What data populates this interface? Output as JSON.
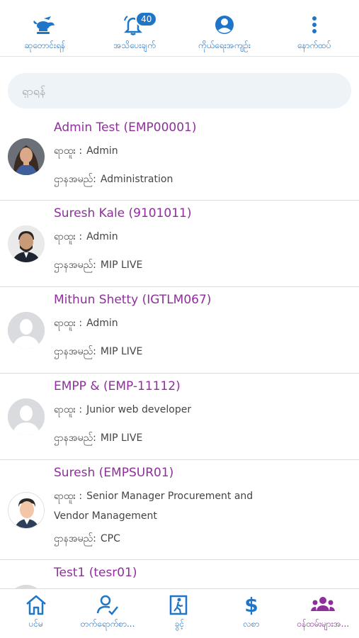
{
  "top_nav": {
    "items": [
      {
        "label": "ဆုတောင်းရန်",
        "icon": "teapot-lamp-icon"
      },
      {
        "label": "အသိပေးချက်",
        "icon": "bell-icon",
        "badge": "40"
      },
      {
        "label": "ကိုယ်ရေးအကျဉ်း",
        "icon": "account-circle-icon"
      },
      {
        "label": "နောက်ထပ်",
        "icon": "more-vertical-icon"
      }
    ]
  },
  "search": {
    "placeholder": "ရှာရန်"
  },
  "employees": {
    "position_label": "ရာထူး :",
    "department_label": "ဌာနအမည်:",
    "items": [
      {
        "name": "Admin Test (EMP00001)",
        "position": "Admin",
        "department": "Administration",
        "avatar": "photo-woman"
      },
      {
        "name": "Suresh Kale (9101011)",
        "position": "Admin",
        "department": "MIP LIVE",
        "avatar": "photo-man"
      },
      {
        "name": "Mithun Shetty (IGTLM067)",
        "position": "Admin",
        "department": "MIP LIVE",
        "avatar": "placeholder"
      },
      {
        "name": "EMPP & (EMP-11112)",
        "position": "Junior web developer",
        "department": "MIP LIVE",
        "avatar": "placeholder"
      },
      {
        "name": "Suresh (EMPSUR01)",
        "position": "Senior Manager  Procurement and",
        "position_cont": "Vendor Management",
        "department": "CPC",
        "avatar": "cartoon-man"
      },
      {
        "name": "Test1 (tesr01)",
        "avatar": "placeholder"
      }
    ]
  },
  "bottom_nav": {
    "items": [
      {
        "label": "ပင်မ",
        "icon": "home-icon"
      },
      {
        "label": "တက်ရောက်စာ...",
        "icon": "attendance-icon"
      },
      {
        "label": "ခွင့်",
        "icon": "leave-exit-icon"
      },
      {
        "label": "လစာ",
        "icon": "dollar-icon"
      },
      {
        "label": "ဝန်ထမ်းများအ...",
        "icon": "people-icon",
        "active": true
      }
    ]
  },
  "colors": {
    "accent": "#1f76c8",
    "name_purple": "#8e2f9c",
    "search_bg": "#eef3f8"
  }
}
